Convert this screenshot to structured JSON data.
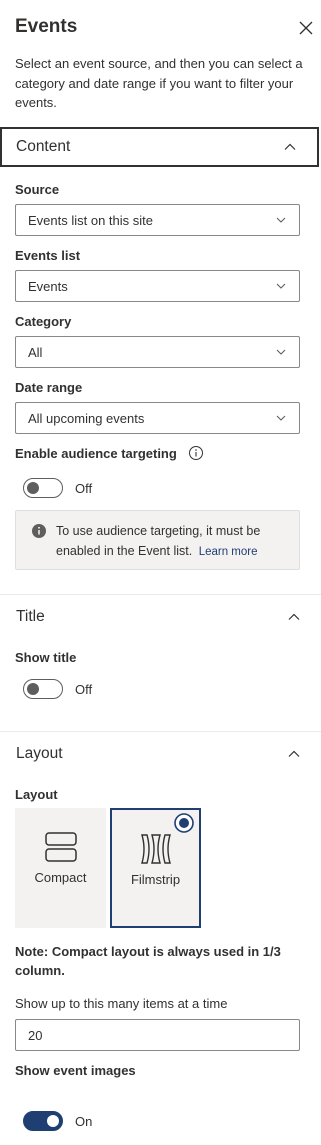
{
  "panel": {
    "title": "Events",
    "description": "Select an event source, and then you can select a category and date range if you want to filter your events."
  },
  "content_section": {
    "header": "Content",
    "source": {
      "label": "Source",
      "value": "Events list on this site"
    },
    "events_list": {
      "label": "Events list",
      "value": "Events"
    },
    "category": {
      "label": "Category",
      "value": "All"
    },
    "date_range": {
      "label": "Date range",
      "value": "All upcoming events"
    },
    "audience": {
      "label": "Enable audience targeting",
      "toggle_state": "Off",
      "message": "To use audience targeting, it must be enabled in the Event list.",
      "learn_more": "Learn more"
    }
  },
  "title_section": {
    "header": "Title",
    "show_title": {
      "label": "Show title",
      "toggle_state": "Off"
    }
  },
  "layout_section": {
    "header": "Layout",
    "layout_label": "Layout",
    "options": [
      {
        "label": "Compact",
        "selected": false
      },
      {
        "label": "Filmstrip",
        "selected": true
      }
    ],
    "note": "Note: Compact layout is always used in 1/3 column.",
    "items_label": "Show up to this many items at a time",
    "items_value": "20",
    "show_images": {
      "label": "Show event images",
      "toggle_state": "On"
    }
  },
  "colors": {
    "accent": "#1f3f73",
    "border": "#8a8886",
    "text": "#323130",
    "message_bg": "#f3f2f1"
  },
  "icons": [
    "close-icon",
    "chevron-up-icon",
    "chevron-down-icon",
    "info-icon",
    "compact-layout-icon",
    "filmstrip-layout-icon",
    "radio-selected-icon"
  ]
}
